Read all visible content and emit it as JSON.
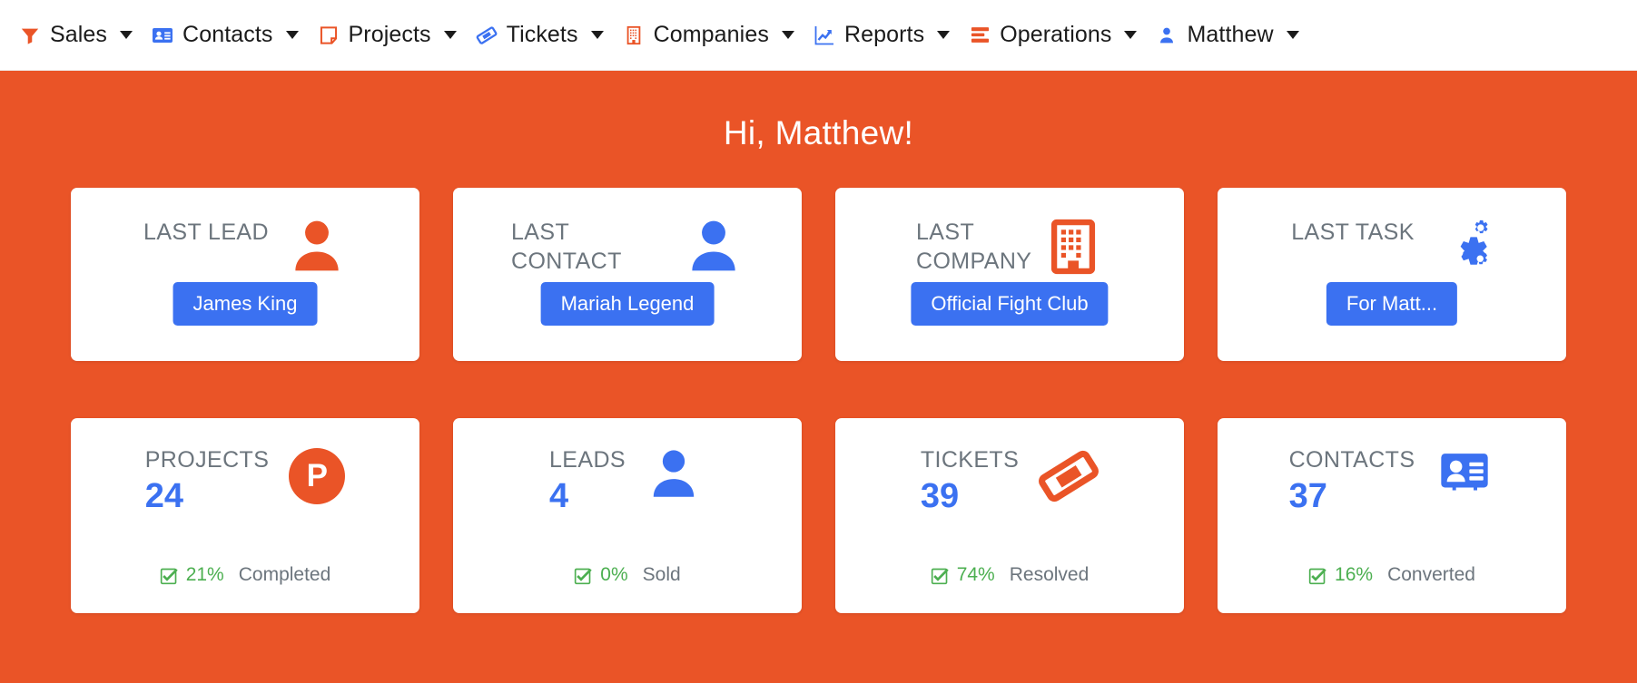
{
  "colors": {
    "brand_orange": "#EA5427",
    "accent_blue": "#3B71F1",
    "green": "#4CAF50",
    "muted_gray": "#6C757D"
  },
  "navbar": {
    "items": [
      {
        "label": "Sales",
        "icon": "funnel-icon",
        "icon_color": "#EA5427",
        "caret": true
      },
      {
        "label": "Contacts",
        "icon": "id-card-icon",
        "icon_color": "#3B71F1",
        "caret": true
      },
      {
        "label": "Projects",
        "icon": "note-icon",
        "icon_color": "#EA5427",
        "caret": true
      },
      {
        "label": "Tickets",
        "icon": "ticket-icon",
        "icon_color": "#3B71F1",
        "caret": true
      },
      {
        "label": "Companies",
        "icon": "building-icon",
        "icon_color": "#EA5427",
        "caret": true
      },
      {
        "label": "Reports",
        "icon": "chart-line-icon",
        "icon_color": "#3B71F1",
        "caret": true
      },
      {
        "label": "Operations",
        "icon": "list-bars-icon",
        "icon_color": "#EA5427",
        "caret": true
      },
      {
        "label": "Matthew",
        "icon": "user-icon",
        "icon_color": "#3B71F1",
        "caret": true
      }
    ]
  },
  "hero": {
    "greeting": "Hi, Matthew!"
  },
  "summary_cards": [
    {
      "title": "LAST LEAD",
      "icon": "person-icon",
      "button": "James King"
    },
    {
      "title": "LAST CONTACT",
      "icon": "person-icon",
      "button": "Mariah Legend"
    },
    {
      "title": "LAST COMPANY",
      "icon": "building-icon",
      "button": "Official Fight Club"
    },
    {
      "title": "LAST TASK",
      "icon": "gears-icon",
      "button": "For Matt..."
    }
  ],
  "stat_cards": [
    {
      "label": "PROJECTS",
      "value": "24",
      "icon": "p-circle-icon",
      "percent": "21%",
      "status": "Completed"
    },
    {
      "label": "LEADS",
      "value": "4",
      "icon": "person-icon",
      "percent": "0%",
      "status": "Sold"
    },
    {
      "label": "TICKETS",
      "value": "39",
      "icon": "ticket-icon",
      "percent": "74%",
      "status": "Resolved"
    },
    {
      "label": "CONTACTS",
      "value": "37",
      "icon": "id-card-icon",
      "percent": "16%",
      "status": "Converted"
    }
  ]
}
